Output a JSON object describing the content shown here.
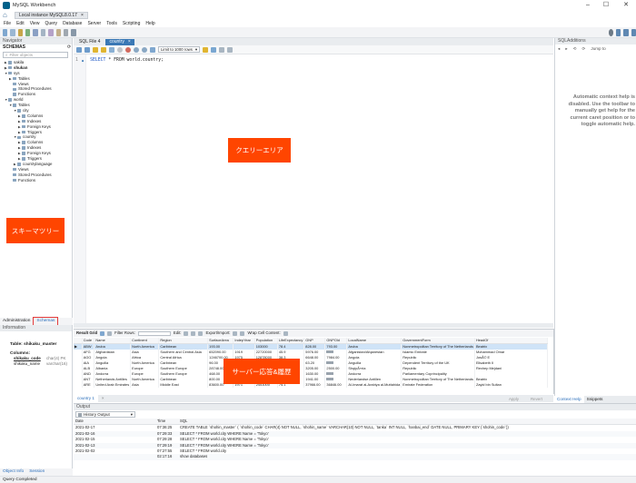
{
  "window": {
    "title": "MySQL Workbench",
    "controls": [
      "–",
      "☐",
      "✕"
    ]
  },
  "connection_tab": {
    "label": "Local instance MySQL8.0.17",
    "close": "×"
  },
  "menu": [
    "File",
    "Edit",
    "View",
    "Query",
    "Database",
    "Server",
    "Tools",
    "Scripting",
    "Help"
  ],
  "navigator": {
    "header": "Navigator",
    "schemas_label": "SCHEMAS",
    "filter_placeholder": "Filter objects",
    "tree": [
      {
        "label": "sakila",
        "depth": 0,
        "arrow": "▶",
        "bold": false
      },
      {
        "label": "shukan",
        "depth": 0,
        "arrow": "▶",
        "bold": true
      },
      {
        "label": "sys",
        "depth": 0,
        "arrow": "▼",
        "bold": false
      },
      {
        "label": "Tables",
        "depth": 1,
        "arrow": "▶",
        "bold": false
      },
      {
        "label": "Views",
        "depth": 1,
        "arrow": "",
        "bold": false
      },
      {
        "label": "Stored Procedures",
        "depth": 1,
        "arrow": "",
        "bold": false
      },
      {
        "label": "Functions",
        "depth": 1,
        "arrow": "",
        "bold": false
      },
      {
        "label": "world",
        "depth": 0,
        "arrow": "▼",
        "bold": false
      },
      {
        "label": "Tables",
        "depth": 1,
        "arrow": "▼",
        "bold": false
      },
      {
        "label": "city",
        "depth": 2,
        "arrow": "▼",
        "bold": false
      },
      {
        "label": "Columns",
        "depth": 3,
        "arrow": "▶",
        "bold": false
      },
      {
        "label": "Indexes",
        "depth": 3,
        "arrow": "▶",
        "bold": false
      },
      {
        "label": "Foreign Keys",
        "depth": 3,
        "arrow": "▶",
        "bold": false
      },
      {
        "label": "Triggers",
        "depth": 3,
        "arrow": "▶",
        "bold": false
      },
      {
        "label": "country",
        "depth": 2,
        "arrow": "▼",
        "bold": false
      },
      {
        "label": "Columns",
        "depth": 3,
        "arrow": "▶",
        "bold": false
      },
      {
        "label": "Indexes",
        "depth": 3,
        "arrow": "▶",
        "bold": false
      },
      {
        "label": "Foreign Keys",
        "depth": 3,
        "arrow": "▶",
        "bold": false
      },
      {
        "label": "Triggers",
        "depth": 3,
        "arrow": "▶",
        "bold": false
      },
      {
        "label": "countrylanguage",
        "depth": 2,
        "arrow": "▶",
        "bold": false
      },
      {
        "label": "Views",
        "depth": 1,
        "arrow": "",
        "bold": false
      },
      {
        "label": "Stored Procedures",
        "depth": 1,
        "arrow": "",
        "bold": false
      },
      {
        "label": "Functions",
        "depth": 1,
        "arrow": "",
        "bold": false
      }
    ],
    "bottom_tabs": [
      "Administration",
      "Schemas"
    ]
  },
  "information": {
    "header": "Information",
    "table_label": "Table:",
    "table_name": "shikaku_master",
    "columns_label": "Columns:",
    "columns": [
      {
        "name": "shikaku_code",
        "type": "char(4) PK"
      },
      {
        "name": "shikaku_name",
        "type": "varchar(16)"
      }
    ],
    "tabs": [
      "Object Info",
      "Session"
    ]
  },
  "callouts": {
    "schema_tree": "スキーマツリー",
    "query_area": "クエリーエリア",
    "server_response": "サーバー応答&履歴"
  },
  "editor": {
    "tabs": [
      "SQL File 4",
      "country"
    ],
    "active_tab_close": "×",
    "limit_label": "Limit to 1000 rows",
    "line_number": "1",
    "bullet": "●",
    "sql_keyword": "SELECT",
    "sql_rest": "* FROM world.country;"
  },
  "result": {
    "toolbar": [
      "Result Grid",
      "Filter Rows:",
      "Edit:",
      "Export/Import:",
      "Wrap Cell Content:"
    ],
    "columns": [
      "Code",
      "Name",
      "Continent",
      "Region",
      "SurfaceArea",
      "IndepYear",
      "Population",
      "LifeExpectancy",
      "GNP",
      "GNPOld",
      "LocalName",
      "GovernmentForm",
      "HeadOf"
    ],
    "rows": [
      [
        "ABW",
        "Aruba",
        "North America",
        "Caribbean",
        "193.00",
        "",
        "103000",
        "78.4",
        "828.00",
        "793.00",
        "Aruba",
        "Nonmetropolitan Territory of The Netherlands",
        "Beatrix"
      ],
      [
        "AFG",
        "Afghanistan",
        "Asia",
        "Southern and Central Asia",
        "652090.00",
        "1919",
        "22720000",
        "45.9",
        "5976.00",
        "",
        "Afganistan/Afqanestan",
        "Islamic Emirate",
        "Mohammad Omar"
      ],
      [
        "AGO",
        "Angola",
        "Africa",
        "Central Africa",
        "1246700.00",
        "1975",
        "12878000",
        "38.3",
        "6648.00",
        "7984.00",
        "Angola",
        "Republic",
        "JosÃ© E"
      ],
      [
        "AIA",
        "Anguilla",
        "North America",
        "Caribbean",
        "96.00",
        "",
        "8000",
        "76.1",
        "63.20",
        "",
        "Anguilla",
        "Dependent Territory of the UK",
        "Elisabeth II"
      ],
      [
        "ALB",
        "Albania",
        "Europe",
        "Southern Europe",
        "28748.00",
        "1912",
        "3401200",
        "71.6",
        "3205.00",
        "2500.00",
        "ShqipÃ«ria",
        "Republic",
        "Rexhep Mejdani"
      ],
      [
        "AND",
        "Andorra",
        "Europe",
        "Southern Europe",
        "468.00",
        "1278",
        "78000",
        "83.5",
        "1630.00",
        "",
        "Andorra",
        "Parliamentary Coprincipality",
        ""
      ],
      [
        "ANT",
        "Netherlands Antilles",
        "North America",
        "Caribbean",
        "800.00",
        "",
        "217000",
        "74.7",
        "1941.00",
        "",
        "Nederlandse Antillen",
        "Nonmetropolitan Territory of The Netherlands",
        "Beatrix"
      ],
      [
        "ARE",
        "United Arab Emirates",
        "Asia",
        "Middle East",
        "83600.00",
        "1971",
        "2441000",
        "74.1",
        "37966.00",
        "36846.00",
        "Al-Imarat al-Arabiya al-Muttahida",
        "Emirate Federation",
        "Zayid bin Sultan"
      ]
    ],
    "side_buttons": [
      "Result Grid",
      "Form Editor",
      "Field Types"
    ],
    "tab_label": "country 1",
    "apply": "Apply",
    "revert": "Revert"
  },
  "sql_additions": {
    "header": "SQLAdditions",
    "jump_to": "Jump to",
    "hint": "Automatic context help is disabled. Use the toolbar to manually get help for the current caret position or to toggle automatic help.",
    "tabs": [
      "Context Help",
      "Snippets"
    ]
  },
  "output": {
    "header": "Output",
    "dropdown": "History Output",
    "columns": [
      "Date",
      "Time",
      "SQL"
    ],
    "rows": [
      [
        "2021-02-17",
        "07:36:25",
        "CREATE TABLE `shohin_master` ( `shohin_code` CHAR(4) NOT NULL, `shohin_name` VARCHAR(10) NOT NULL, `tanka` INT NULL, `hanbai_end` DATE NULL, PRIMARY KEY (`shohin_code`))"
      ],
      [
        "2021-02-16",
        "07:29:33",
        "SELECT * FROM world.city WHERE Name = 'Tokyo'"
      ],
      [
        "2021-02-15",
        "07:29:28",
        "SELECT * FROM world.city WHERE Name = 'Tokyo'"
      ],
      [
        "2021-02-13",
        "07:29:19",
        "SELECT * FROM world.city WHERE Name = 'Tokyo'"
      ],
      [
        "2021-02-02",
        "07:27:55",
        "SELECT * FROM world.city"
      ],
      [
        "",
        "02:17:16",
        "show databases"
      ]
    ]
  },
  "status": "Query Completed",
  "colors": {
    "accent": "#3a78b5",
    "callout": "#ff4500",
    "selection": "#cfe3f7"
  }
}
